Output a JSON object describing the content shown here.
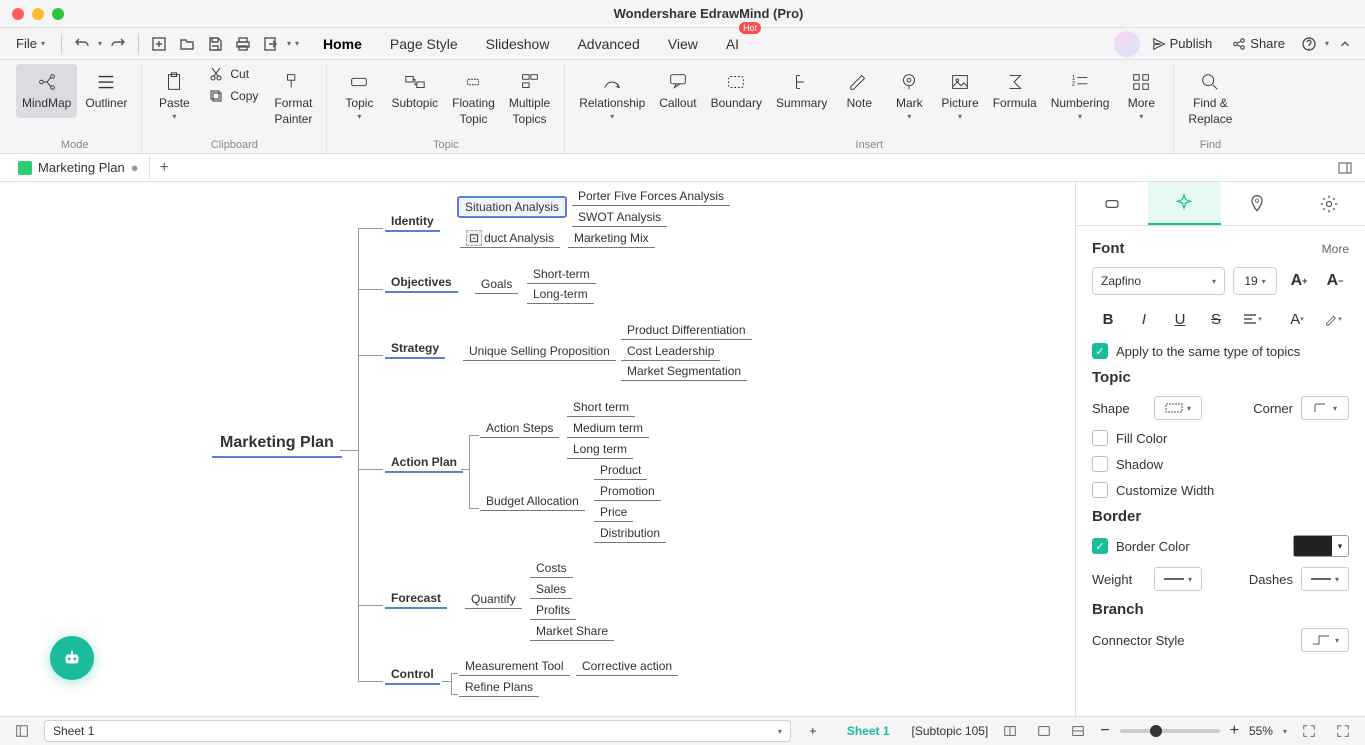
{
  "window": {
    "title": "Wondershare EdrawMind (Pro)"
  },
  "menubar": {
    "file": "File",
    "tabs": [
      "Home",
      "Page Style",
      "Slideshow",
      "Advanced",
      "View",
      "AI"
    ],
    "active_tab": "Home",
    "hot_badge": "Hot",
    "publish": "Publish",
    "share": "Share"
  },
  "ribbon": {
    "mode": {
      "mindmap": "MindMap",
      "outliner": "Outliner",
      "label": "Mode"
    },
    "clipboard": {
      "paste": "Paste",
      "cut": "Cut",
      "copy": "Copy",
      "format_painter": "Format\nPainter",
      "label": "Clipboard"
    },
    "topic_group": {
      "topic": "Topic",
      "subtopic": "Subtopic",
      "floating": "Floating\nTopic",
      "multiple": "Multiple\nTopics",
      "label": "Topic"
    },
    "insert": {
      "relationship": "Relationship",
      "callout": "Callout",
      "boundary": "Boundary",
      "summary": "Summary",
      "note": "Note",
      "mark": "Mark",
      "picture": "Picture",
      "formula": "Formula",
      "numbering": "Numbering",
      "more": "More",
      "label": "Insert"
    },
    "find": {
      "find_replace": "Find &\nReplace",
      "label": "Find"
    }
  },
  "doctab": {
    "name": "Marketing Plan"
  },
  "canvas": {
    "root": "Marketing Plan",
    "branches": [
      {
        "name": "Identity",
        "children": [
          {
            "name": "Situation Analysis",
            "selected": true,
            "children": [
              "Porter Five Forces Analysis",
              "SWOT Analysis"
            ]
          },
          {
            "name": "duct Analysis",
            "prefix_icon": true,
            "children": [
              "Marketing Mix"
            ]
          }
        ]
      },
      {
        "name": "Objectives",
        "children": [
          {
            "name": "Goals",
            "children": [
              "Short-term",
              "Long-term"
            ]
          }
        ]
      },
      {
        "name": "Strategy",
        "children": [
          {
            "name": "Unique Selling Proposition",
            "children": [
              "Product Differentiation",
              "Cost Leadership",
              "Market Segmentation"
            ]
          }
        ]
      },
      {
        "name": "Action Plan",
        "children": [
          {
            "name": "Action Steps",
            "children": [
              "Short term",
              "Medium term",
              "Long term"
            ]
          },
          {
            "name": "Budget Allocation",
            "children": [
              "Product",
              "Promotion",
              "Price",
              "Distribution"
            ]
          }
        ]
      },
      {
        "name": "Forecast",
        "children": [
          {
            "name": "Quantify",
            "children": [
              "Costs",
              "Sales",
              "Profits",
              "Market Share"
            ]
          }
        ]
      },
      {
        "name": "Control",
        "children": [
          {
            "name": "Measurement Tool",
            "children": []
          },
          {
            "name": "Corrective action",
            "children": [],
            "inline": true
          },
          {
            "name": "Refine Plans",
            "children": []
          }
        ]
      }
    ]
  },
  "sidepanel": {
    "font": {
      "title": "Font",
      "more": "More",
      "family": "Zapfino",
      "size": "19",
      "apply_same": "Apply to the same type of topics"
    },
    "topic": {
      "title": "Topic",
      "shape_label": "Shape",
      "corner_label": "Corner",
      "fill": "Fill Color",
      "shadow": "Shadow",
      "custom_width": "Customize Width"
    },
    "border": {
      "title": "Border",
      "color_label": "Border Color",
      "weight_label": "Weight",
      "dashes_label": "Dashes",
      "color": "#222222"
    },
    "branch": {
      "title": "Branch",
      "connector_label": "Connector Style"
    }
  },
  "statusbar": {
    "sheet_selector": "Sheet 1",
    "active_sheet": "Sheet 1",
    "selection": "[Subtopic 105]",
    "zoom": "55%"
  }
}
